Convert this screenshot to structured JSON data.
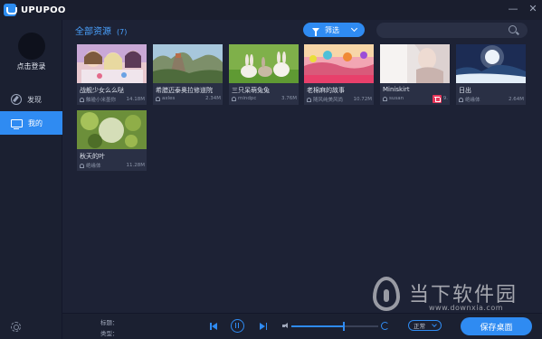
{
  "app": {
    "name": "UPUPOO"
  },
  "window": {
    "minimize": "—",
    "close": "✕"
  },
  "sidebar": {
    "login_label": "点击登录",
    "items": [
      {
        "label": "发现",
        "icon": "compass-icon",
        "active": false
      },
      {
        "label": "我的",
        "icon": "monitor-icon",
        "active": true
      }
    ]
  },
  "main": {
    "title": "全部资源",
    "count": "(7)",
    "filter_label": "筛选",
    "search_placeholder": ""
  },
  "cards": [
    {
      "title": "战舰少女么么哒",
      "author": "触碰小米墨你",
      "size": "14.18M"
    },
    {
      "title": "希腊迈泰奥拉修道院",
      "author": "axles",
      "size": "2.34M"
    },
    {
      "title": "三只呆萌兔兔",
      "author": "mindpc",
      "size": "3.76M"
    },
    {
      "title": "老棉麻的故事",
      "author": "随风纯美风尚",
      "size": "10.72M"
    },
    {
      "title": "Miniskirt",
      "author": "susan",
      "size": "9.",
      "deletable": true
    },
    {
      "title": "日出",
      "author": "绝缘体",
      "size": "2.64M"
    },
    {
      "title": "秋天的叶",
      "author": "绝缘体",
      "size": "11.28M"
    }
  ],
  "player": {
    "title_label": "标题：",
    "type_label": "类型：",
    "volume": 0.6,
    "mode_label": "正常",
    "save_label": "保存桌面"
  },
  "watermark": {
    "name": "当下软件园",
    "url": "www.downxia.com"
  },
  "colors": {
    "accent": "#2f8bf2",
    "background": "#1d2235",
    "delete": "#e8365a"
  }
}
